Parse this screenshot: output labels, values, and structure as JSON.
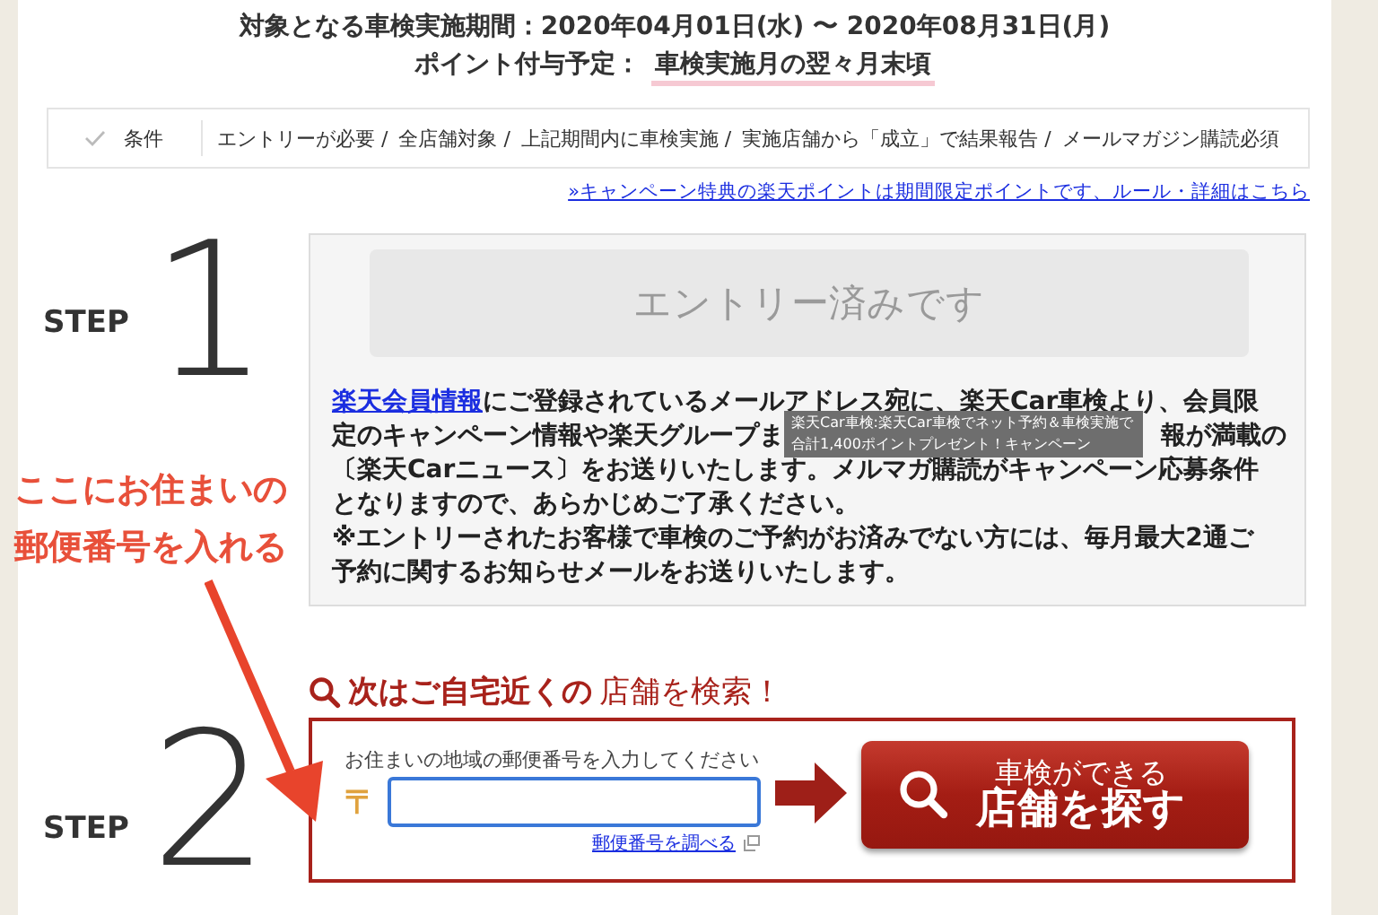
{
  "header": {
    "period_label": "対象となる車検実施期間：",
    "period_value": "2020年04月01日(水) 〜 2020年08月31日(月)",
    "points_label": "ポイント付与予定：",
    "points_value": "車検実施月の翌々月末頃"
  },
  "conditions": {
    "label": "条件",
    "items": [
      "エントリーが必要 /",
      "全店舗対象 /",
      "上記期間内に車検実施 /",
      "実施店舗から「成立」で結果報告 /",
      "メールマガジン購読必須"
    ]
  },
  "rules_link": "»キャンペーン特典の楽天ポイントは期間限定ポイントです、ルール・詳細はこちら",
  "step1": {
    "step": "STEP",
    "number": "1",
    "entry_button": {
      "label": "エントリー済みです",
      "disabled": true
    },
    "lines": [
      {
        "parts": [
          {
            "text": "楽天会員情報",
            "link": true
          },
          {
            "text": "にご登録されているメールアドレス宛に、楽天Car車検より、会員限",
            "link": false
          }
        ]
      },
      {
        "parts": [
          {
            "text": "定のキャンペーン情報や楽天グループま",
            "link": false
          },
          {
            "text": "報が満載の",
            "link": false
          }
        ]
      },
      {
        "parts": [
          {
            "text": "〔楽天Carニュース〕をお送りいたします。メルマガ購読がキャンペーン応募条件",
            "link": false
          }
        ]
      },
      {
        "parts": [
          {
            "text": "となりますので、あらかじめご了承ください。",
            "link": false
          }
        ]
      },
      {
        "parts": [
          {
            "text": "※エントリーされたお客様で車検のご予約がお済みでない方には、毎月最大2通ご",
            "link": false
          }
        ]
      },
      {
        "parts": [
          {
            "text": "予約に関するお知らせメールをお送りいたします。",
            "link": false
          }
        ]
      }
    ],
    "tooltip": [
      "楽天Car車検:楽天Car車検でネット予約＆車検実施で",
      "合計1,400ポイントプレゼント！キャンペーン"
    ]
  },
  "step2": {
    "step": "STEP",
    "number": "2",
    "heading_bold": "次はご自宅近くの",
    "heading_rest": "店舗を検索！",
    "field_label": "お住まいの地域の郵便番号を入力してください",
    "postal_mark": "〒",
    "postal_link": "郵便番号を調べる",
    "search_button": [
      "車検ができる",
      "店舗を探す"
    ]
  },
  "annotation": {
    "lines": [
      "ここにお住まいの",
      "郵便番号を入れる"
    ]
  }
}
